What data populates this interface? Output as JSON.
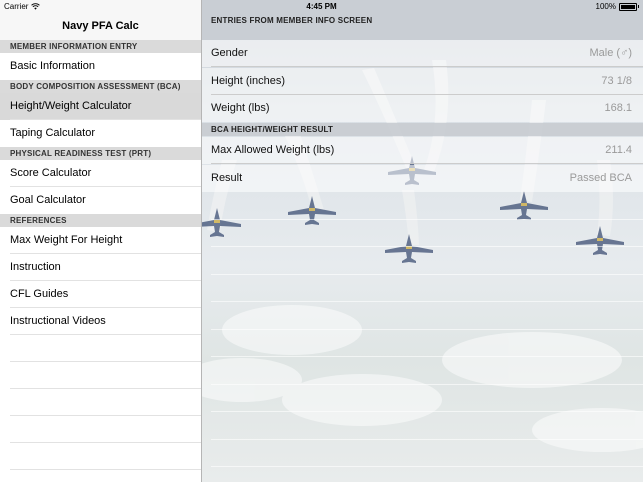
{
  "status_bar": {
    "carrier": "Carrier",
    "time": "4:45 PM",
    "battery": "100%"
  },
  "master": {
    "title": "Navy PFA Calc",
    "sections": [
      {
        "header": "MEMBER INFORMATION ENTRY",
        "items": [
          "Basic Information"
        ]
      },
      {
        "header": "BODY COMPOSITION ASSESSMENT (BCA)",
        "items": [
          "Height/Weight Calculator",
          "Taping Calculator"
        ]
      },
      {
        "header": "PHYSICAL READINESS TEST (PRT)",
        "items": [
          "Score Calculator",
          "Goal Calculator"
        ]
      },
      {
        "header": "REFERENCES",
        "items": [
          "Max Weight For Height",
          "Instruction",
          "CFL Guides",
          "Instructional Videos"
        ]
      }
    ],
    "selected_item": "Height/Weight Calculator"
  },
  "detail": {
    "section1_header": "ENTRIES FROM MEMBER INFO SCREEN",
    "rows1": [
      {
        "label": "Gender",
        "value": "Male (♂)"
      },
      {
        "label": "Height (inches)",
        "value": "73 1/8"
      },
      {
        "label": "Weight (lbs)",
        "value": "168.1"
      }
    ],
    "section2_header": "BCA HEIGHT/WEIGHT RESULT",
    "rows2": [
      {
        "label": "Max Allowed Weight (lbs)",
        "value": "211.4"
      },
      {
        "label": "Result",
        "value": "Passed BCA"
      }
    ]
  }
}
